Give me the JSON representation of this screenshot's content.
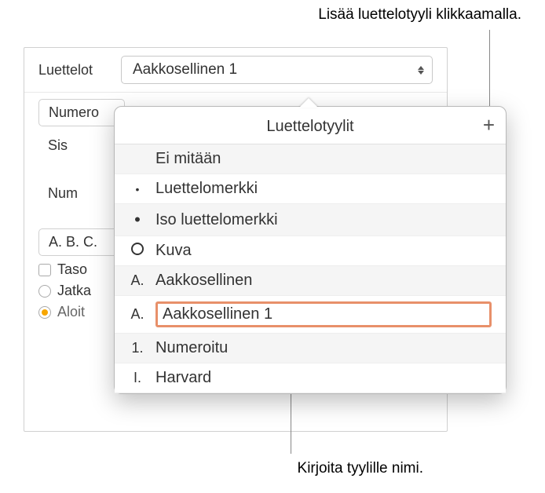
{
  "callouts": {
    "top": "Lisää luettelotyyli klikkaamalla.",
    "bottom": "Kirjoita tyylille nimi."
  },
  "panel": {
    "list_label": "Luettelot",
    "dropdown_value": "Aakkosellinen 1",
    "numbering_partial": "Numero",
    "indent_label": "Sis",
    "num_label": "Num",
    "example": "A. B. C.",
    "level_label": "Taso",
    "continue_label": "Jatka",
    "start_label": "Aloit"
  },
  "popover": {
    "title": "Luettelotyylit",
    "plus": "+",
    "items": [
      {
        "marker": "",
        "label": "Ei mitään"
      },
      {
        "marker": "bullet-sm",
        "label": "Luettelomerkki"
      },
      {
        "marker": "bullet-lg",
        "label": "Iso luettelomerkki"
      },
      {
        "marker": "ring",
        "label": "Kuva"
      },
      {
        "marker_text": "A.",
        "label": "Aakkosellinen"
      },
      {
        "marker_text": "A.",
        "label": "Aakkosellinen 1",
        "editing": true
      },
      {
        "marker_text": "1.",
        "label": "Numeroitu"
      },
      {
        "marker_text": "I.",
        "label": "Harvard"
      }
    ]
  }
}
